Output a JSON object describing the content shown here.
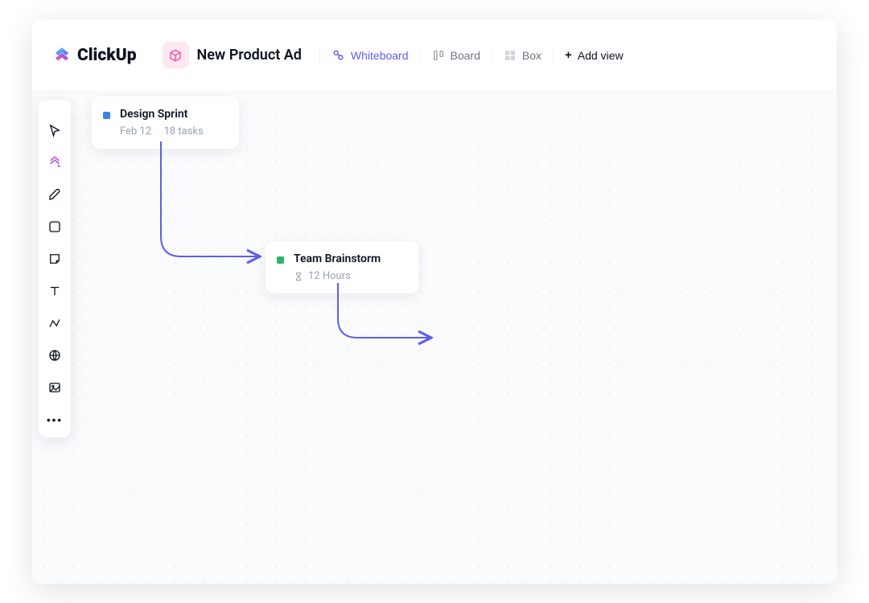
{
  "logo": {
    "word": "ClickUp"
  },
  "header": {
    "title": "New Product Ad",
    "views": {
      "whiteboard": "Whiteboard",
      "board": "Board",
      "box": "Box",
      "add": "Add view"
    }
  },
  "tools": {
    "pointer": "pointer-tool",
    "clickup": "clickup-tool",
    "pen": "pen-tool",
    "shape": "shape-tool",
    "note": "note-tool",
    "text": "text-tool",
    "connector": "connector-tool",
    "web": "web-tool",
    "image": "image-tool",
    "more": "more-tool"
  },
  "cards": {
    "design_sprint": {
      "title": "Design Sprint",
      "date": "Feb 12",
      "tasks": "18 tasks",
      "color": "#3482f6"
    },
    "team_brainstorm": {
      "title": "Team Brainstorm",
      "duration": "12 Hours",
      "color": "#2fb26c"
    }
  },
  "colors": {
    "accent": "#5e5df0",
    "pink": "#f957a3"
  }
}
